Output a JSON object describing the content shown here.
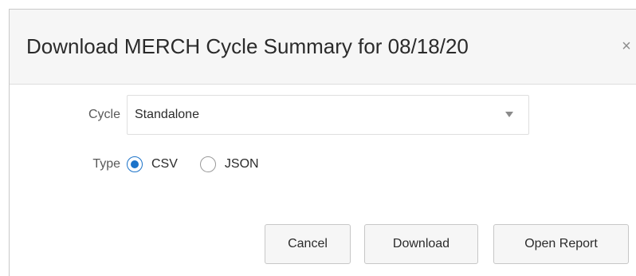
{
  "dialog": {
    "title": "Download MERCH Cycle Summary for 08/18/20",
    "close_glyph": "×"
  },
  "form": {
    "cycle": {
      "label": "Cycle",
      "selected_value": "Standalone"
    },
    "type": {
      "label": "Type",
      "options": [
        {
          "label": "CSV",
          "checked": true
        },
        {
          "label": "JSON",
          "checked": false
        }
      ]
    }
  },
  "buttons": {
    "cancel_label": "Cancel",
    "download_label": "Download",
    "open_report_label": "Open Report"
  },
  "colors": {
    "accent": "#1c73c9",
    "header_bg": "#f6f6f6",
    "button_bg": "#f6f6f6"
  },
  "icons": {
    "close": "close-icon",
    "dropdown": "chevron-down-icon"
  }
}
